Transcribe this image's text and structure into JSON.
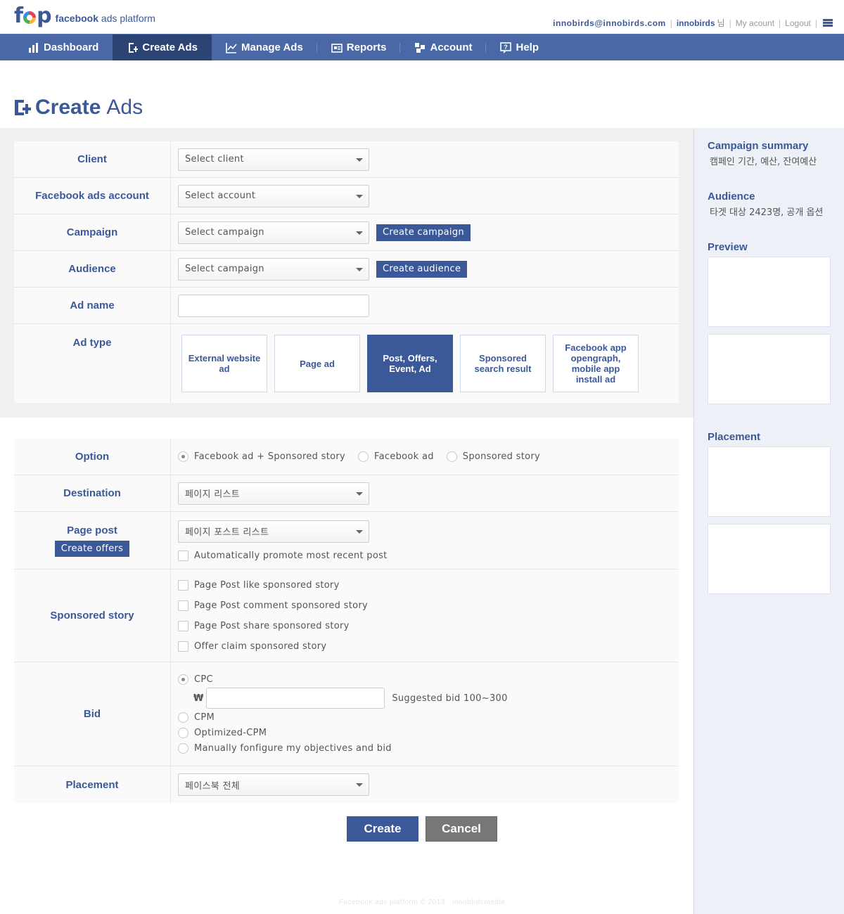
{
  "brand": {
    "mark_left": "f",
    "mark_right": "p",
    "name_bold": "facebook",
    "name_rest": " ads platform"
  },
  "user": {
    "email": "innobirds@innobirds.com",
    "name": "innobirds",
    "honorific": "님",
    "my_account": "My acount",
    "logout": "Logout",
    "menu_icon": "list-icon"
  },
  "nav": [
    {
      "label": "Dashboard",
      "icon": "dashboard-icon",
      "active": false
    },
    {
      "label": "Create Ads",
      "icon": "create-ads-icon",
      "active": true
    },
    {
      "label": "Manage Ads",
      "icon": "chart-icon",
      "active": false
    },
    {
      "label": "Reports",
      "icon": "reports-icon",
      "active": false
    },
    {
      "label": "Account",
      "icon": "account-icon",
      "active": false
    },
    {
      "label": "Help",
      "icon": "help-icon",
      "active": false
    }
  ],
  "title": {
    "bold": "Create",
    "rest": "Ads"
  },
  "form1": {
    "client": {
      "label": "Client",
      "value": "Select client"
    },
    "fb_account": {
      "label": "Facebook ads account",
      "value": "Select account"
    },
    "campaign": {
      "label": "Campaign",
      "value": "Select campaign",
      "button": "Create campaign"
    },
    "audience": {
      "label": "Audience",
      "value": "Select campaign",
      "button": "Create audience"
    },
    "ad_name": {
      "label": "Ad name",
      "value": ""
    },
    "ad_type": {
      "label": "Ad type",
      "options": [
        {
          "label": "External website ad",
          "selected": false
        },
        {
          "label": "Page ad",
          "selected": false
        },
        {
          "label": "Post, Offers, Event, Ad",
          "selected": true
        },
        {
          "label": "Sponsored search result",
          "selected": false
        },
        {
          "label": "Facebook app opengraph, mobile app install ad",
          "selected": false
        }
      ]
    }
  },
  "form2": {
    "option": {
      "label": "Option",
      "choices": [
        "Facebook ad + Sponsored story",
        "Facebook ad",
        "Sponsored story"
      ],
      "selected": "Facebook ad + Sponsored story"
    },
    "destination": {
      "label": "Destination",
      "value": "페이지 리스트"
    },
    "page_post": {
      "label": "Page post",
      "button": "Create offers",
      "value": "페이지 포스트 리스트",
      "auto_promote": "Automatically promote most recent post"
    },
    "sponsored_story": {
      "label": "Sponsored story",
      "items": [
        "Page Post like sponsored story",
        "Page Post comment sponsored story",
        "Page Post share sponsored story",
        "Offer claim sponsored story"
      ]
    },
    "bid": {
      "label": "Bid",
      "cpc": "CPC",
      "currency": "₩",
      "value": "",
      "suggested": "Suggested bid 100~300",
      "cpm": "CPM",
      "ocpm": "Optimized-CPM",
      "manual": "Manually fonfigure my objectives and bid",
      "selected": "CPC"
    },
    "placement": {
      "label": "Placement",
      "value": "페이스북 전체"
    }
  },
  "actions": {
    "create": "Create",
    "cancel": "Cancel"
  },
  "sidebar": {
    "campaign_summary": {
      "title": "Campaign summary",
      "text": "캠페인 기간, 예산, 잔여예산"
    },
    "audience": {
      "title": "Audience",
      "text": "타겟 대상 2423명, 공개 옵션"
    },
    "preview": {
      "title": "Preview"
    },
    "placement": {
      "title": "Placement"
    }
  },
  "footer": "Facebook ads platform © 2013 · innobirdsmedia",
  "colors": {
    "brand": "#3b5998",
    "nav_bg": "#4a68a6",
    "nav_active": "#2d4373",
    "cancel": "#777777"
  }
}
